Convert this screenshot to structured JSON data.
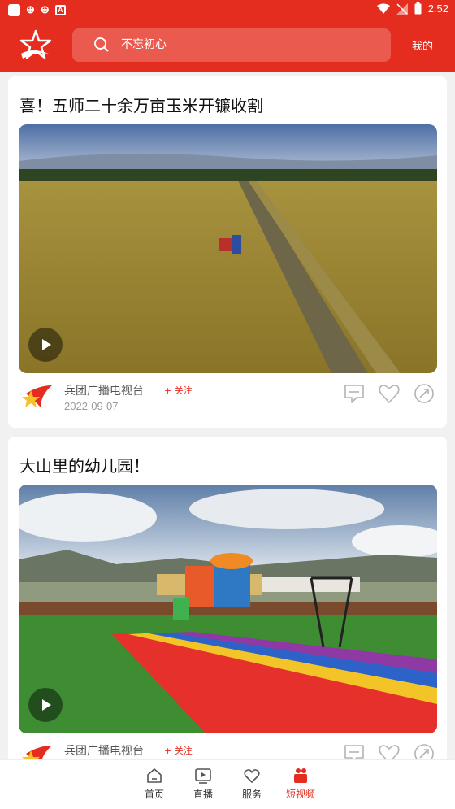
{
  "status_bar": {
    "time": "2:52"
  },
  "header": {
    "search_placeholder": "不忘初心",
    "mine_label": "我的"
  },
  "feed": [
    {
      "title": "喜！五师二十余万亩玉米开镰收割",
      "source": "兵团广播电视台",
      "follow_label": "+ 关注",
      "date": "2022-09-07"
    },
    {
      "title": "大山里的幼儿园！",
      "source": "兵团广播电视台",
      "follow_label": "+ 关注",
      "date": ""
    }
  ],
  "nav": [
    {
      "label": "首页",
      "icon": "home-icon"
    },
    {
      "label": "直播",
      "icon": "live-icon"
    },
    {
      "label": "服务",
      "icon": "heart-icon"
    },
    {
      "label": "短视频",
      "icon": "short-video-icon"
    }
  ],
  "colors": {
    "brand_red": "#e42d1f",
    "search_bg": "#eb5a4e"
  }
}
